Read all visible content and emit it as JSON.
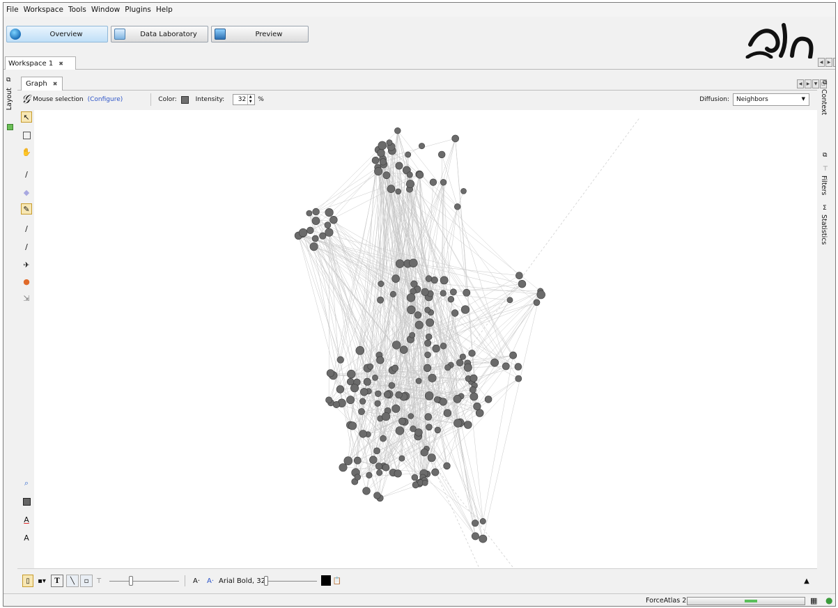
{
  "menu": [
    "File",
    "Workspace",
    "Tools",
    "Window",
    "Plugins",
    "Help"
  ],
  "perspectives": [
    {
      "label": "Overview",
      "active": true,
      "icon": "globe-icon"
    },
    {
      "label": "Data Laboratory",
      "active": false,
      "icon": "table-icon"
    },
    {
      "label": "Preview",
      "active": false,
      "icon": "monitor-icon"
    }
  ],
  "workspace_tab": {
    "label": "Workspace 1"
  },
  "left_panel": {
    "label": "Layout"
  },
  "graph_tab": {
    "label": "Graph"
  },
  "toolbar": {
    "selection_label": "Mouse selection",
    "configure_label": "(Configure)",
    "color_label": "Color:",
    "color_value": "#6f6f6f",
    "intensity_label": "Intensity:",
    "intensity_value": "32",
    "intensity_unit": "%",
    "diffusion_label": "Diffusion:",
    "diffusion_value": "Neighbors"
  },
  "right_panels": [
    "Context",
    "Filters",
    "Statistics"
  ],
  "bottom_toolbar": {
    "font_label": "Arial Bold, 32"
  },
  "status": {
    "layout_name": "ForceAtlas 2"
  },
  "colors": {
    "node": "#6b6b6b",
    "edge": "#c8c8c8",
    "accent": "#2f56c8",
    "progress": "#5bbf5b"
  }
}
